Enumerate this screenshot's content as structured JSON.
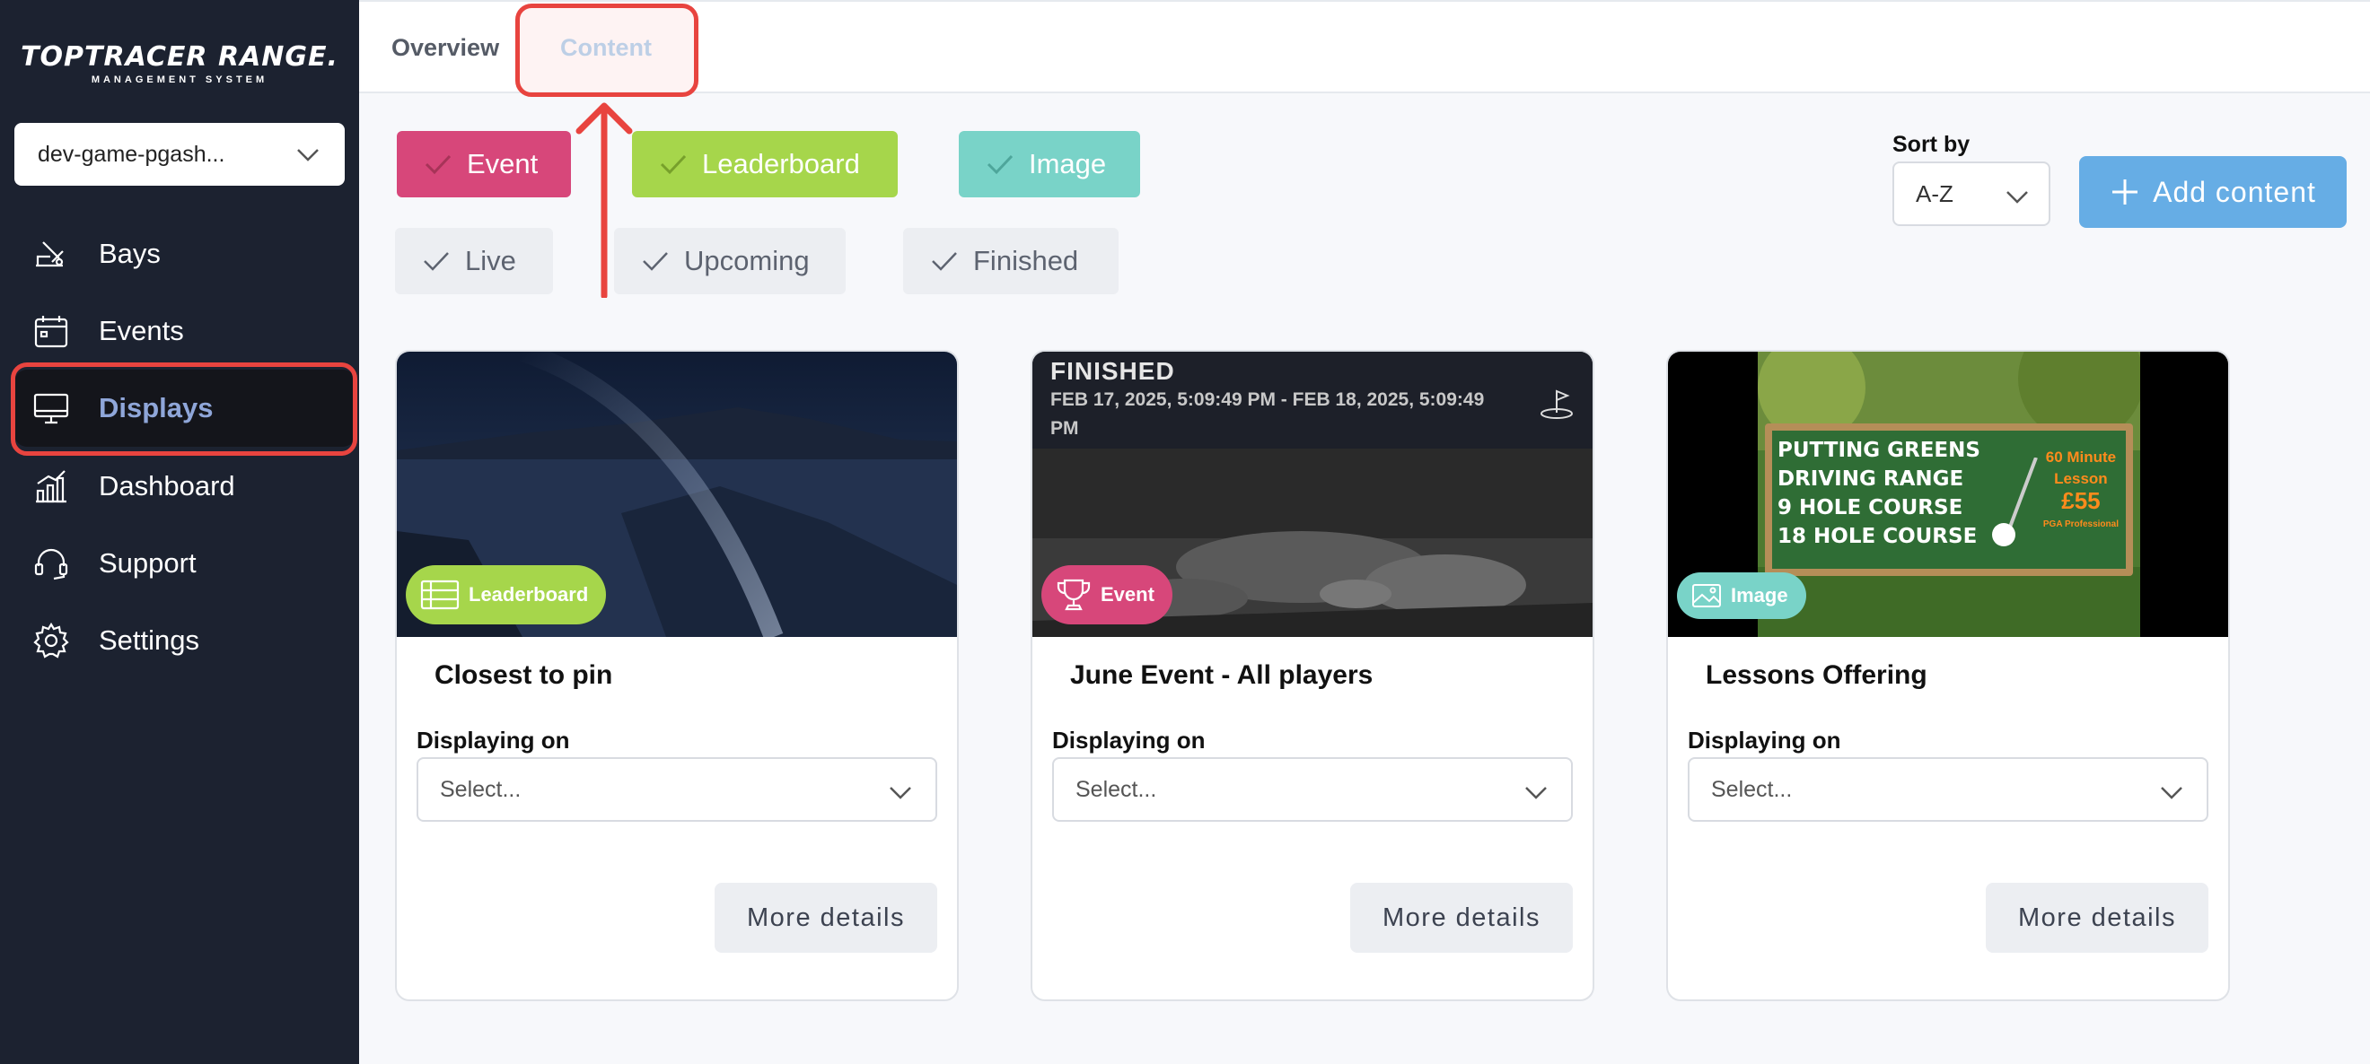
{
  "sidebar": {
    "logo_text": "TOPTRACER RANGE.",
    "logo_subtitle": "MANAGEMENT SYSTEM",
    "venue_select_value": "dev-game-pgash...",
    "items": [
      {
        "label": "Bays",
        "icon": "bays-icon"
      },
      {
        "label": "Events",
        "icon": "calendar-icon"
      },
      {
        "label": "Displays",
        "icon": "monitor-icon",
        "active": true
      },
      {
        "label": "Dashboard",
        "icon": "chart-icon"
      },
      {
        "label": "Support",
        "icon": "headset-icon"
      },
      {
        "label": "Settings",
        "icon": "gear-icon"
      }
    ]
  },
  "tabs": {
    "overview": "Overview",
    "content": "Content"
  },
  "filters": {
    "types": [
      {
        "label": "Event",
        "color": "#d7477a"
      },
      {
        "label": "Leaderboard",
        "color": "#a6d64b"
      },
      {
        "label": "Image",
        "color": "#79d3c8"
      }
    ],
    "statuses": [
      {
        "label": "Live"
      },
      {
        "label": "Upcoming"
      },
      {
        "label": "Finished"
      }
    ]
  },
  "sort": {
    "label": "Sort by",
    "value": "A-Z"
  },
  "add_content_label": "Add content",
  "cards": [
    {
      "title": "Closest to pin",
      "badge": "Leaderboard",
      "badge_color": "#a6d64b",
      "displaying_on_label": "Displaying on",
      "select_placeholder": "Select...",
      "more_details": "More details"
    },
    {
      "title": "June Event - All players",
      "badge": "Event",
      "badge_color": "#d7477a",
      "status": "FINISHED",
      "dates": "FEB 17, 2025, 5:09:49 PM - FEB 18, 2025, 5:09:49 PM",
      "displaying_on_label": "Displaying on",
      "select_placeholder": "Select...",
      "more_details": "More details"
    },
    {
      "title": "Lessons Offering",
      "badge": "Image",
      "badge_color": "#79d3c8",
      "sign_lines": [
        "PUTTING GREENS",
        "DRIVING RANGE",
        "9 HOLE COURSE",
        "18 HOLE COURSE"
      ],
      "sign_promo": [
        "60 Minute",
        "Lesson",
        "£55",
        "PGA Professional"
      ],
      "displaying_on_label": "Displaying on",
      "select_placeholder": "Select...",
      "more_details": "More details"
    }
  ],
  "colors": {
    "sidebar_bg": "#1c2230",
    "accent_blue": "#66ade5",
    "highlight_red": "#e8443f"
  }
}
